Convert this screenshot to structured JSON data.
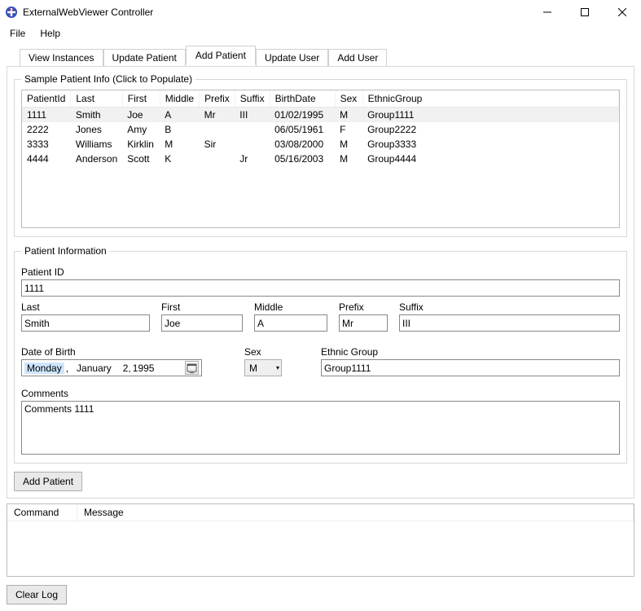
{
  "window": {
    "title": "ExternalWebViewer Controller"
  },
  "menu": {
    "file": "File",
    "help": "Help"
  },
  "tabs": {
    "view_instances": "View Instances",
    "update_patient": "Update Patient",
    "add_patient": "Add Patient",
    "update_user": "Update User",
    "add_user": "Add User"
  },
  "sample_group": {
    "legend": "Sample Patient Info (Click to Populate)",
    "headers": {
      "patientId": "PatientId",
      "last": "Last",
      "first": "First",
      "middle": "Middle",
      "prefix": "Prefix",
      "suffix": "Suffix",
      "birthDate": "BirthDate",
      "sex": "Sex",
      "ethnicGroup": "EthnicGroup"
    },
    "rows": [
      {
        "patientId": "1111",
        "last": "Smith",
        "first": "Joe",
        "middle": "A",
        "prefix": "Mr",
        "suffix": "III",
        "birthDate": "01/02/1995",
        "sex": "M",
        "ethnicGroup": "Group1111"
      },
      {
        "patientId": "2222",
        "last": "Jones",
        "first": "Amy",
        "middle": "B",
        "prefix": "",
        "suffix": "",
        "birthDate": "06/05/1961",
        "sex": "F",
        "ethnicGroup": "Group2222"
      },
      {
        "patientId": "3333",
        "last": "Williams",
        "first": "Kirklin",
        "middle": "M",
        "prefix": "Sir",
        "suffix": "",
        "birthDate": "03/08/2000",
        "sex": "M",
        "ethnicGroup": "Group3333"
      },
      {
        "patientId": "4444",
        "last": "Anderson",
        "first": "Scott",
        "middle": "K",
        "prefix": "",
        "suffix": "Jr",
        "birthDate": "05/16/2003",
        "sex": "M",
        "ethnicGroup": "Group4444"
      }
    ]
  },
  "info_group": {
    "legend": "Patient Information",
    "labels": {
      "patientId": "Patient ID",
      "last": "Last",
      "first": "First",
      "middle": "Middle",
      "prefix": "Prefix",
      "suffix": "Suffix",
      "dob": "Date of Birth",
      "sex": "Sex",
      "ethnic": "Ethnic Group",
      "comments": "Comments"
    },
    "values": {
      "patientId": "1111",
      "last": "Smith",
      "first": "Joe",
      "middle": "A",
      "prefix": "Mr",
      "suffix": "III",
      "dob_weekday": "Monday",
      "dob_sep": ",",
      "dob_month": "January",
      "dob_day": "2,",
      "dob_year": "1995",
      "sex": "M",
      "ethnic": "Group1111",
      "comments": "Comments 1111"
    }
  },
  "buttons": {
    "add_patient": "Add Patient",
    "clear_log": "Clear Log"
  },
  "log": {
    "headers": {
      "command": "Command",
      "message": "Message"
    }
  }
}
